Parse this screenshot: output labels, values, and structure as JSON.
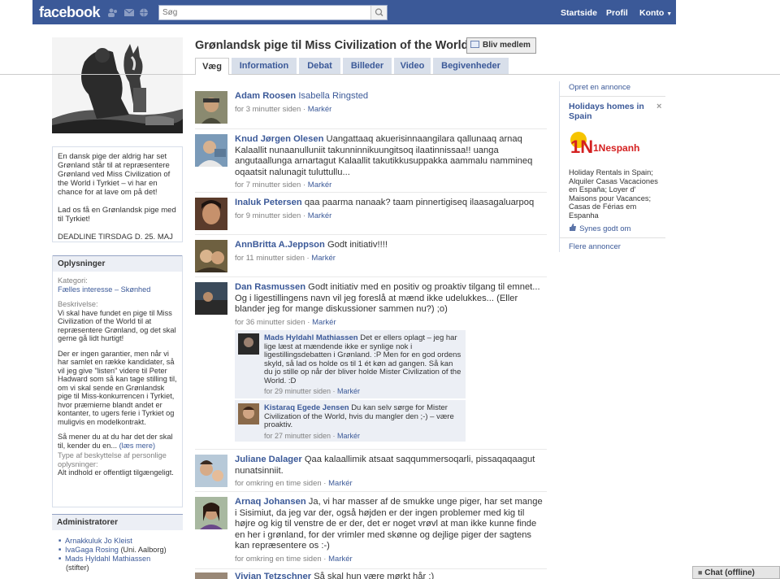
{
  "topbar": {
    "logo": "facebook",
    "search_placeholder": "Søg",
    "nav": [
      "Startside",
      "Profil",
      "Konto"
    ]
  },
  "group": {
    "title": "Grønlandsk pige til Miss Civilization of the World",
    "join_label": "Bliv medlem",
    "tabs": [
      "Væg",
      "Information",
      "Debat",
      "Billeder",
      "Video",
      "Begivenheder"
    ],
    "about": [
      "En dansk pige der aldrig har set Grønland står til at repræsentere Grønland ved Miss Civilization of the World i Tyrkiet – vi har en chance for at lave om på det!",
      "Lad os få en Grønlandsk pige med til Tyrkiet!",
      "DEADLINE TIRSDAG D. 25. MAJ"
    ]
  },
  "info": {
    "header": "Oplysninger",
    "category_label": "Kategori:",
    "category_value": "Fælles interesse – Skønhed",
    "description_label": "Beskrivelse:",
    "description_1": "Vi skal have fundet en pige til Miss Civilization of the World til at repræsentere Grønland, og det skal gerne gå lidt hurtigt!",
    "description_2": "Der er ingen garantier, men når vi har samlet en række kandidater, så vil jeg give \"listen\" videre til Peter Hadward som så kan tage stilling til, om vi skal sende en Grønlandsk pige til Miss-konkurrencen i Tyrkiet, hvor præmierne blandt andet er kontanter, to ugers ferie i Tyrkiet og muligvis en modelkontrakt.",
    "description_3": "Så mener du at du har det der skal til, kender du en...",
    "read_more": "(læs mere)",
    "type_label": "Type af beskyttelse af personlige oplysninger:",
    "type_value": "Alt indhold er offentligt tilgængeligt."
  },
  "admins": {
    "header": "Administratorer",
    "items": [
      {
        "name": "Arnakkuluk Jo Kleist",
        "extra": ""
      },
      {
        "name": "IvaGaga Rosing",
        "extra": " (Uni. Aalborg)"
      },
      {
        "name": "Mads Hyldahl Mathiassen",
        "extra": ""
      }
    ],
    "founder_note": "(stifter)"
  },
  "feed": {
    "mark_label": "Markér",
    "posts": [
      {
        "name": "Adam Roosen",
        "text": "",
        "target": "Isabella Ringsted",
        "time": "for 3 minutter siden"
      },
      {
        "name": "Knud Jørgen Olesen",
        "text": "Uangattaaq akuerisinnaangilara qallunaaq arnaq Kalaallit nunaanulluniit takunninnikuungitsoq ilaatinnissaa!! uanga angutaallunga arnartagut Kalaallit takutikkusuppakka aammalu nammineq oqaatsit nalunagit tuluttullu...",
        "time": "for 7 minutter siden"
      },
      {
        "name": "Inaluk Petersen",
        "text": "qaa paarma nanaak? taam pinnertigiseq ilaasagaluarpoq",
        "time": "for 9 minutter siden"
      },
      {
        "name": "AnnBritta A.Jeppson",
        "text": "Godt initiativ!!!!",
        "time": "for 11 minutter siden"
      },
      {
        "name": "Dan Rasmussen",
        "text": "Godt initiativ med en positiv og proaktiv tilgang til emnet... Og i ligestillingens navn vil jeg foreslå at mænd ikke udelukkes... (Eller blander jeg for mange diskussioner sammen nu?) ;o)",
        "time": "for 36 minutter siden"
      },
      {
        "name": "Juliane Dalager",
        "text": "Qaa kalaallimik atsaat saqqummersoqarli, pissaqaqaagut nunatsinniit.",
        "time": "for omkring en time siden"
      },
      {
        "name": "Arnaq Johansen",
        "text": "Ja, vi har masser af de smukke unge piger, har set mange i Sisimiut, da jeg var der, også højden er der ingen problemer med kig til højre og kig til venstre de er der, det er noget vrøvl at man ikke kunne finde en her i grønland, for der vrimler med skønne og dejlige piger der sagtens kan repræsentere os :-)",
        "time": "for omkring en time siden"
      },
      {
        "name": "Vivian Tetzschner",
        "text": "Så skal hun være mørkt hår :)",
        "time": ""
      }
    ],
    "comments": [
      {
        "name": "Mads Hyldahl Mathiassen",
        "text": "Det er ellers oplagt – jeg har lige læst at mændende ikke er synlige nok i ligestillingsdebatten i Grønland. :P Men for en god ordens skyld, så lad os holde os til 1 ét køn ad gangen. Så kan du jo stille op når der bliver holde Mister Civilization of the World. :D",
        "time": "for 29 minutter siden"
      },
      {
        "name": "Kistaraq Egede Jensen",
        "text": "Du kan selv sørge for Mister Civilization of the World, hvis du mangler den ;-) – være proaktiv.",
        "time": "for 27 minutter siden"
      }
    ]
  },
  "ads": {
    "create_ad": "Opret en annonce",
    "title": "Holidays homes in Spain",
    "logo_text": "1Nespanha.com",
    "body": "Holiday Rentals in Spain; Alquiler Casas Vacaciones en España; Loyer d' Maisons pour Vacances; Casas de Férias em Espanha",
    "like": "Synes godt om",
    "more_ads": "Flere annoncer"
  },
  "chat": {
    "label": "Chat (offline)"
  }
}
